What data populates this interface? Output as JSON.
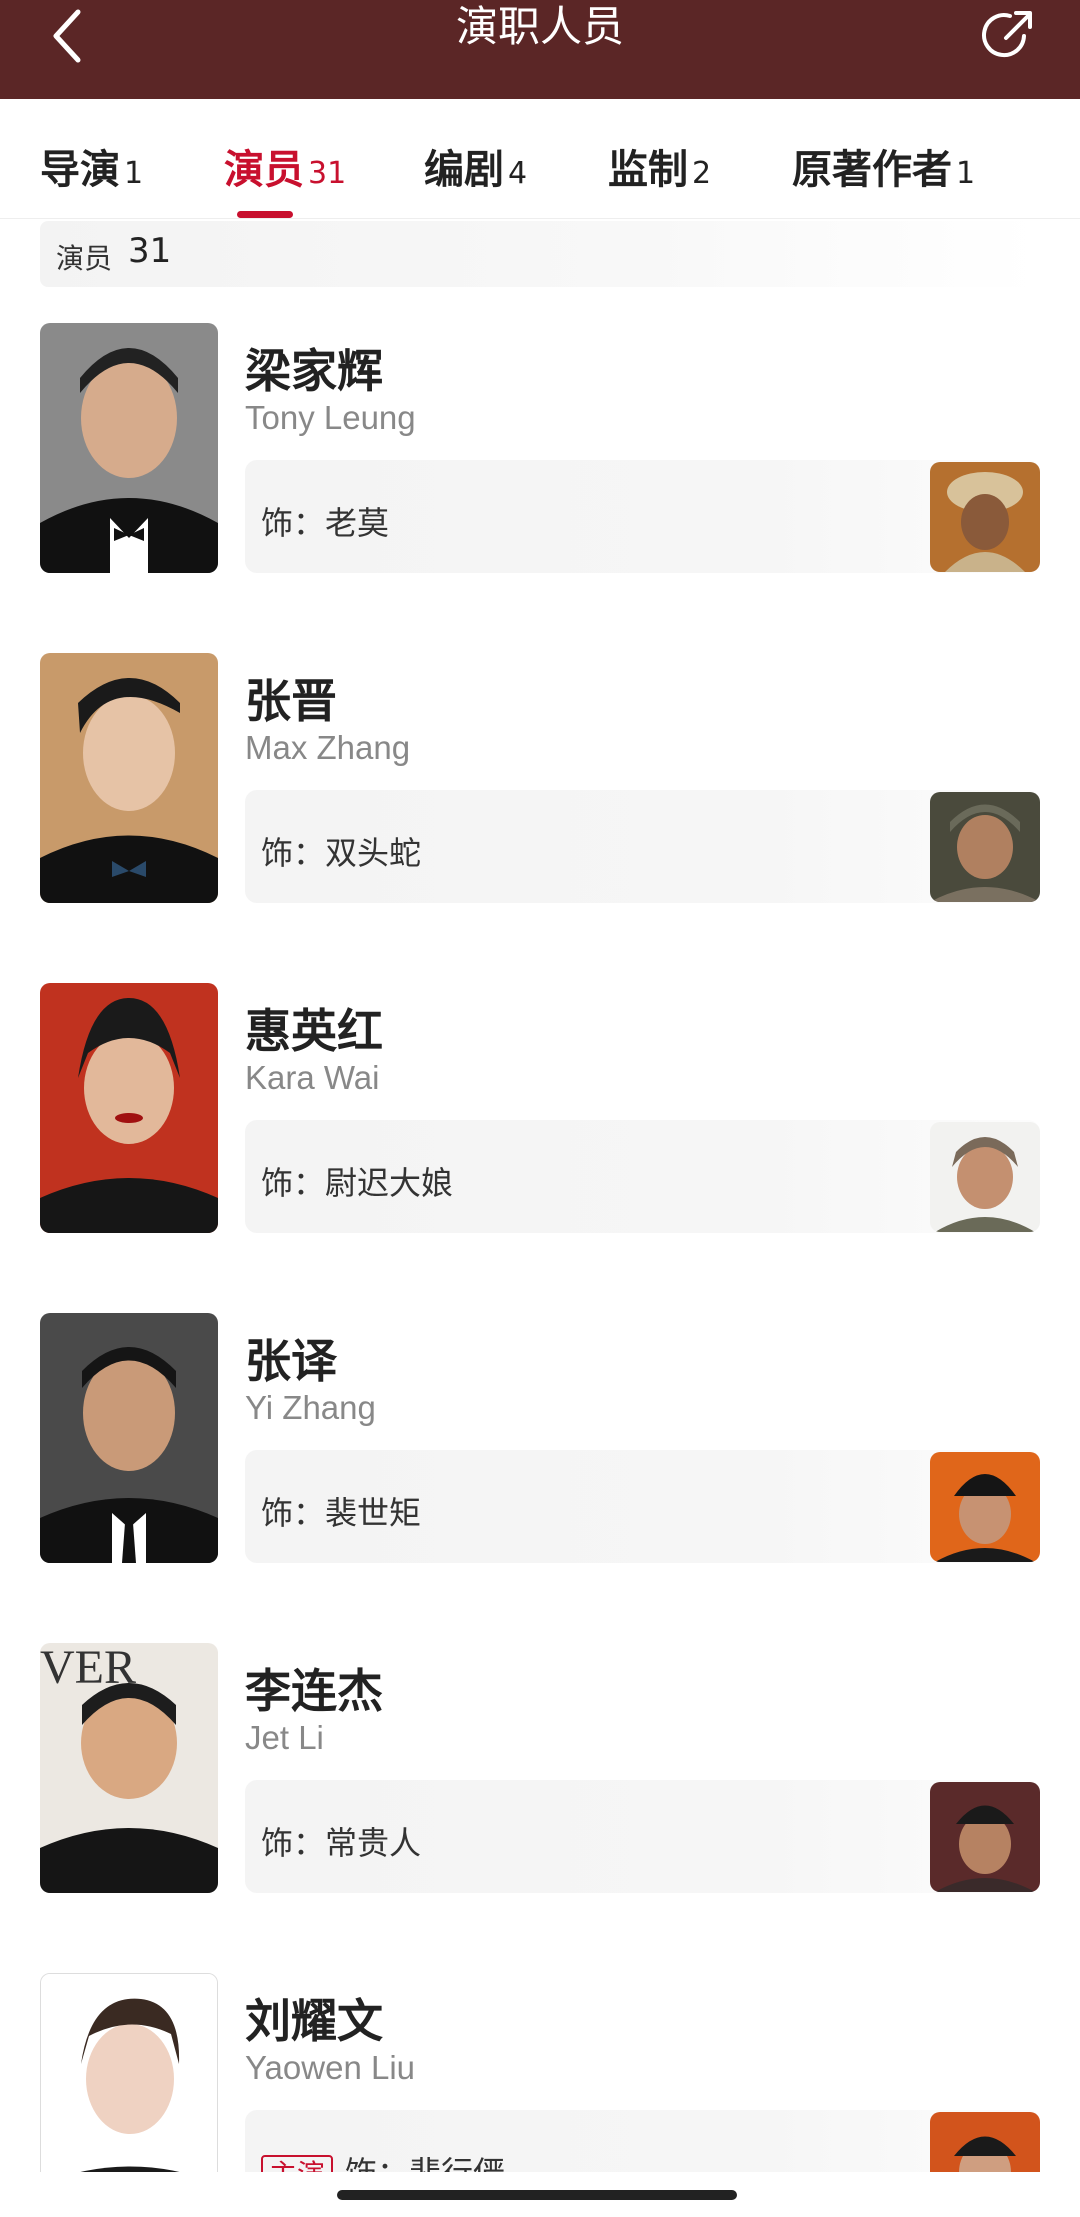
{
  "header": {
    "title": "演职人员",
    "back_icon": "chevron-left-icon",
    "share_icon": "share-icon"
  },
  "tabs": [
    {
      "label": "导演",
      "count": "1",
      "active": false
    },
    {
      "label": "演员",
      "count": "31",
      "active": true
    },
    {
      "label": "编剧",
      "count": "4",
      "active": false
    },
    {
      "label": "监制",
      "count": "2",
      "active": false
    },
    {
      "label": "原著作者",
      "count": "1",
      "active": false
    }
  ],
  "section": {
    "label": "演员",
    "count": "31"
  },
  "cast": [
    {
      "name": "梁家辉",
      "en": "Tony Leung",
      "role": "饰：老莫"
    },
    {
      "name": "张晋",
      "en": "Max Zhang",
      "role": "饰：双头蛇"
    },
    {
      "name": "惠英红",
      "en": "Kara Wai",
      "role": "饰：尉迟大娘"
    },
    {
      "name": "张译",
      "en": "Yi Zhang",
      "role": "饰：裴世矩"
    },
    {
      "name": "李连杰",
      "en": "Jet Li",
      "role": "饰：常贵人"
    },
    {
      "name": "刘耀文",
      "en": "Yaowen Liu",
      "role": "饰：裴行俨",
      "badge": "主演"
    }
  ],
  "colors": {
    "header_bg": "#5b2626",
    "accent": "#c8102e"
  }
}
